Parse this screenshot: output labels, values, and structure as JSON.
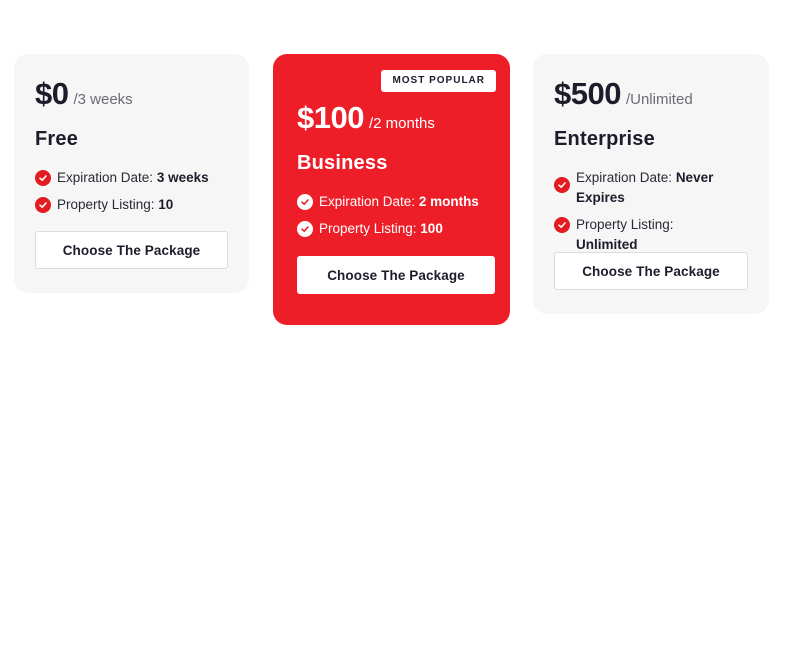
{
  "plans": [
    {
      "price": "$0",
      "period": "/3 weeks",
      "name": "Free",
      "features": [
        {
          "label": "Expiration Date: ",
          "value": "3 weeks"
        },
        {
          "label": "Property Listing: ",
          "value": "10"
        }
      ],
      "button": "Choose The Package"
    },
    {
      "badge": "MOST POPULAR",
      "price": "$100",
      "period": "/2 months",
      "name": "Business",
      "features": [
        {
          "label": "Expiration Date: ",
          "value": "2 months"
        },
        {
          "label": "Property Listing: ",
          "value": "100"
        }
      ],
      "button": "Choose The Package"
    },
    {
      "price": "$500",
      "period": "/Unlimited",
      "name": "Enterprise",
      "features": [
        {
          "label": "Expiration Date: ",
          "value": "Never Expires"
        },
        {
          "label": "Property Listing: ",
          "value": "Unlimited"
        }
      ],
      "button": "Choose The Package"
    }
  ],
  "colors": {
    "accent": "#ee1e28",
    "card_bg": "#f6f6f6",
    "text": "#1c1c2b"
  },
  "icons": {
    "check": "check-circle-icon"
  }
}
